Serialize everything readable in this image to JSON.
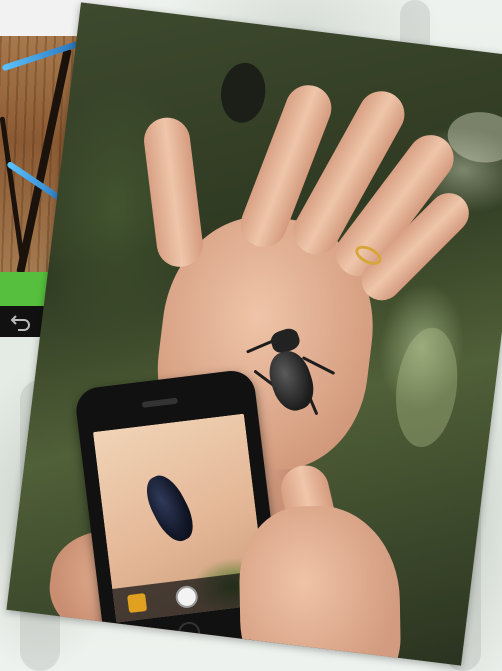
{
  "scene": {
    "description_icons": [
      "chevron-right-icon",
      "back-arrow-icon"
    ],
    "colors": {
      "green_bar": "#56c03e",
      "nav_bar": "#111111",
      "wood": "#8b5a33",
      "foliage": "#2f3a22"
    }
  }
}
